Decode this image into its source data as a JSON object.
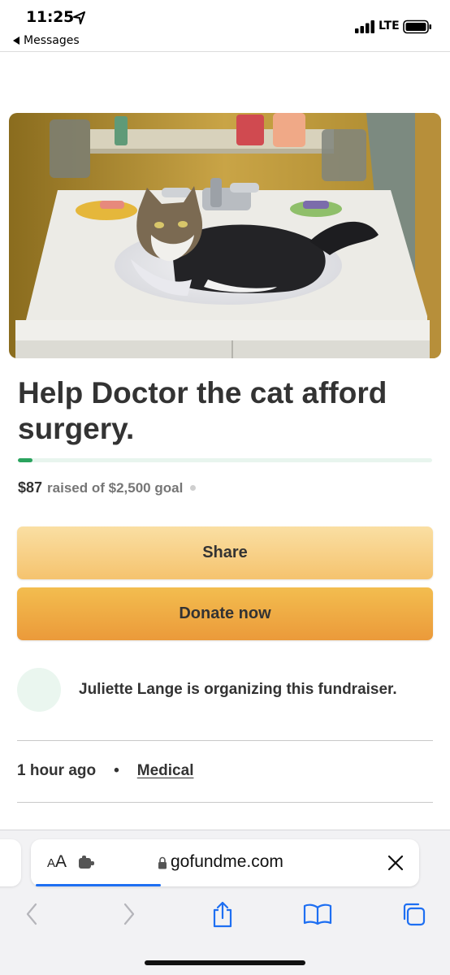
{
  "status_bar": {
    "time": "11:25",
    "back_label": "Messages",
    "network": "LTE"
  },
  "fundraiser": {
    "title": "Help Doctor the cat afford surgery.",
    "raised_amount": "$87",
    "raised_text": "raised of $2,500 goal",
    "progress_fraction": 0.035,
    "share_label": "Share",
    "donate_label": "Donate now",
    "organizer_text": "Juliette Lange is organizing this fundraiser.",
    "time_ago": "1 hour ago",
    "bullet": "•",
    "category": "Medical"
  },
  "browser": {
    "aa_small": "A",
    "aa_big": "A",
    "url": "gofundme.com"
  },
  "colors": {
    "accent_green": "#2aa35e",
    "share_button": "#f5c36e",
    "donate_button": "#eb9a3a",
    "link_blue": "#1e6ff2"
  },
  "icons": [
    "location-arrow-icon",
    "signal-icon",
    "battery-icon",
    "extension-icon",
    "lock-icon",
    "close-icon",
    "back-chevron-icon",
    "forward-chevron-icon",
    "share-icon",
    "bookmarks-icon",
    "tabs-icon"
  ]
}
